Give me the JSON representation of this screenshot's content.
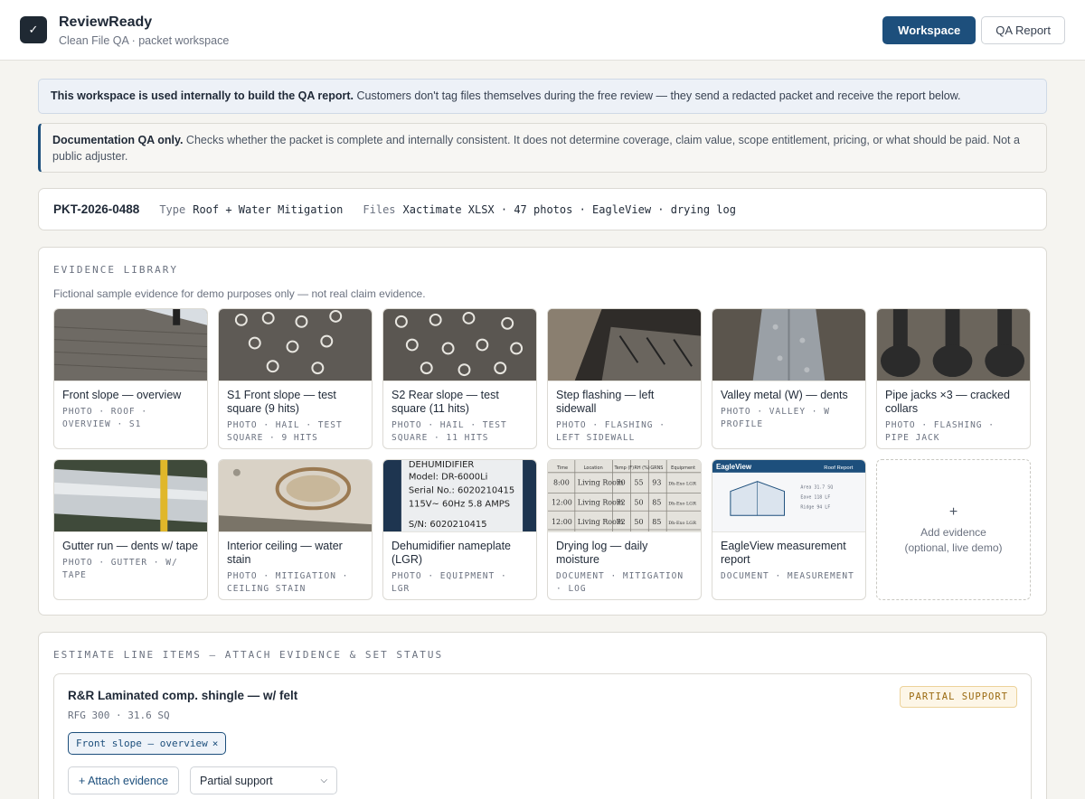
{
  "header": {
    "brand_title": "ReviewReady",
    "brand_sub": "Clean File QA · packet workspace",
    "logo_icon": "check-icon",
    "tabs": [
      {
        "label": "Workspace",
        "active": true
      },
      {
        "label": "QA Report",
        "active": false
      }
    ]
  },
  "notice_internal": {
    "bold": "This workspace is used internally to build the QA report.",
    "text": " Customers don't tag files themselves during the free review — they send a redacted packet and receive the report below."
  },
  "notice_scope": {
    "bold": "Documentation QA only.",
    "text": " Checks whether the packet is complete and internally consistent. It does not determine coverage, claim value, scope entitlement, pricing, or what should be paid. Not a public adjuster."
  },
  "packet": {
    "id": "PKT-2026-0488",
    "type_label": "Type",
    "type_value": "Roof + Water Mitigation",
    "files_label": "Files",
    "files_value": "Xactimate XLSX · 47 photos · EagleView · drying log"
  },
  "evidence": {
    "section_label": "EVIDENCE LIBRARY",
    "note": "Fictional sample evidence for demo purposes only — not real claim evidence.",
    "items": [
      {
        "title": "Front slope — overview",
        "tags": "PHOTO · ROOF · OVERVIEW · S1"
      },
      {
        "title": "S1 Front slope — test square (9 hits)",
        "tags": "PHOTO · HAIL · TEST SQUARE · 9 HITS"
      },
      {
        "title": "S2 Rear slope — test square (11 hits)",
        "tags": "PHOTO · HAIL · TEST SQUARE · 11 HITS"
      },
      {
        "title": "Step flashing — left sidewall",
        "tags": "PHOTO · FLASHING · LEFT SIDEWALL"
      },
      {
        "title": "Valley metal (W) — dents",
        "tags": "PHOTO · VALLEY · W PROFILE"
      },
      {
        "title": "Pipe jacks ×3 — cracked collars",
        "tags": "PHOTO · FLASHING · PIPE JACK"
      },
      {
        "title": "Gutter run — dents w/ tape",
        "tags": "PHOTO · GUTTER · W/ TAPE"
      },
      {
        "title": "Interior ceiling — water stain",
        "tags": "PHOTO · MITIGATION · CEILING STAIN"
      },
      {
        "title": "Dehumidifier nameplate (LGR)",
        "tags": "PHOTO · EQUIPMENT · LGR"
      },
      {
        "title": "Drying log — daily moisture",
        "tags": "DOCUMENT · MITIGATION · LOG"
      },
      {
        "title": "EagleView measurement report",
        "tags": "DOCUMENT · MEASUREMENT"
      }
    ],
    "nameplate": {
      "l1": "DEHUMIDIFIER",
      "l2": "Model: DR-6000Li",
      "l3": "Serial No.: 6020210415",
      "l4": "115V~ 60Hz 5.8 AMPS",
      "l5": "S/N: 6020210415"
    },
    "drying_log": {
      "headers": [
        "Time",
        "Location",
        "Temp (F)",
        "RH (%)",
        "GRNS",
        "Equipment"
      ],
      "rows": [
        [
          "8:00",
          "Living Room",
          "70",
          "55",
          "93",
          "Dh-Exo LGR"
        ],
        [
          "12:00",
          "Living Room",
          "72",
          "50",
          "85",
          "Dh-Exo LGR"
        ],
        [
          "12:00",
          "Living Room",
          "72",
          "50",
          "85",
          "Dh-Exo LGR"
        ]
      ]
    },
    "eagleview": {
      "brand": "EagleView",
      "doc_title": "Roof Report",
      "stats": [
        "Area 31.7 SQ",
        "Eave 118 LF",
        "Ridge 94 LF"
      ]
    },
    "add_label": "Add evidence",
    "add_sub": "(optional, live demo)"
  },
  "line_items": {
    "section_label": "ESTIMATE LINE ITEMS — ATTACH EVIDENCE & SET STATUS",
    "items": [
      {
        "title": "R&R Laminated comp. shingle — w/ felt",
        "code": "RFG 300 · 31.6 SQ",
        "status_badge": "PARTIAL SUPPORT",
        "attached": [
          "Front slope — overview"
        ],
        "attach_label": "+ Attach evidence",
        "status_value": "Partial support"
      }
    ]
  },
  "colors": {
    "primary": "#1d4f7c",
    "badge_text": "#9a6a10",
    "badge_bg": "#fdf6e7"
  }
}
